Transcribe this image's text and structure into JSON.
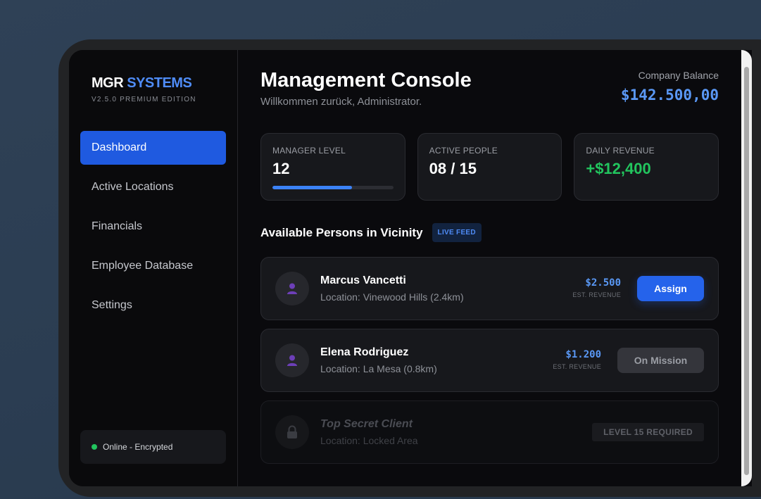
{
  "brand": {
    "name_main": "MGR",
    "name_accent": "SYSTEMS",
    "edition": "V2.5.0 PREMIUM EDITION"
  },
  "sidebar": {
    "items": [
      {
        "label": "Dashboard",
        "active": true
      },
      {
        "label": "Active Locations"
      },
      {
        "label": "Financials"
      },
      {
        "label": "Employee Database"
      },
      {
        "label": "Settings"
      }
    ],
    "status": "Online - Encrypted"
  },
  "header": {
    "title": "Management Console",
    "subtitle": "Willkommen zurück, Administrator.",
    "balance_label": "Company Balance",
    "balance_value": "$142.500,00"
  },
  "stats": {
    "manager_level": {
      "label": "MANAGER LEVEL",
      "value": "12",
      "progress": 0.66
    },
    "active_people": {
      "label": "ACTIVE PEOPLE",
      "value": "08 / 15"
    },
    "daily_revenue": {
      "label": "DAILY REVENUE",
      "value": "+$12,400"
    }
  },
  "section": {
    "title": "Available Persons in Vicinity",
    "badge": "LIVE FEED"
  },
  "persons": [
    {
      "name": "Marcus Vancetti",
      "location": "Location: Vinewood Hills (2.4km)",
      "revenue": "$2.500",
      "revenue_label": "EST. REVENUE",
      "action": "Assign"
    },
    {
      "name": "Elena Rodriguez",
      "location": "Location: La Mesa (0.8km)",
      "revenue": "$1.200",
      "revenue_label": "EST. REVENUE",
      "action": "On Mission"
    },
    {
      "name": "Top Secret Client",
      "location": "Location: Locked Area",
      "requirement": "LEVEL 15 REQUIRED"
    }
  ],
  "colors": {
    "accent": "#2563eb",
    "accent_text": "#4f8cf7",
    "positive": "#22c55e",
    "background": "#0a0a0d"
  }
}
